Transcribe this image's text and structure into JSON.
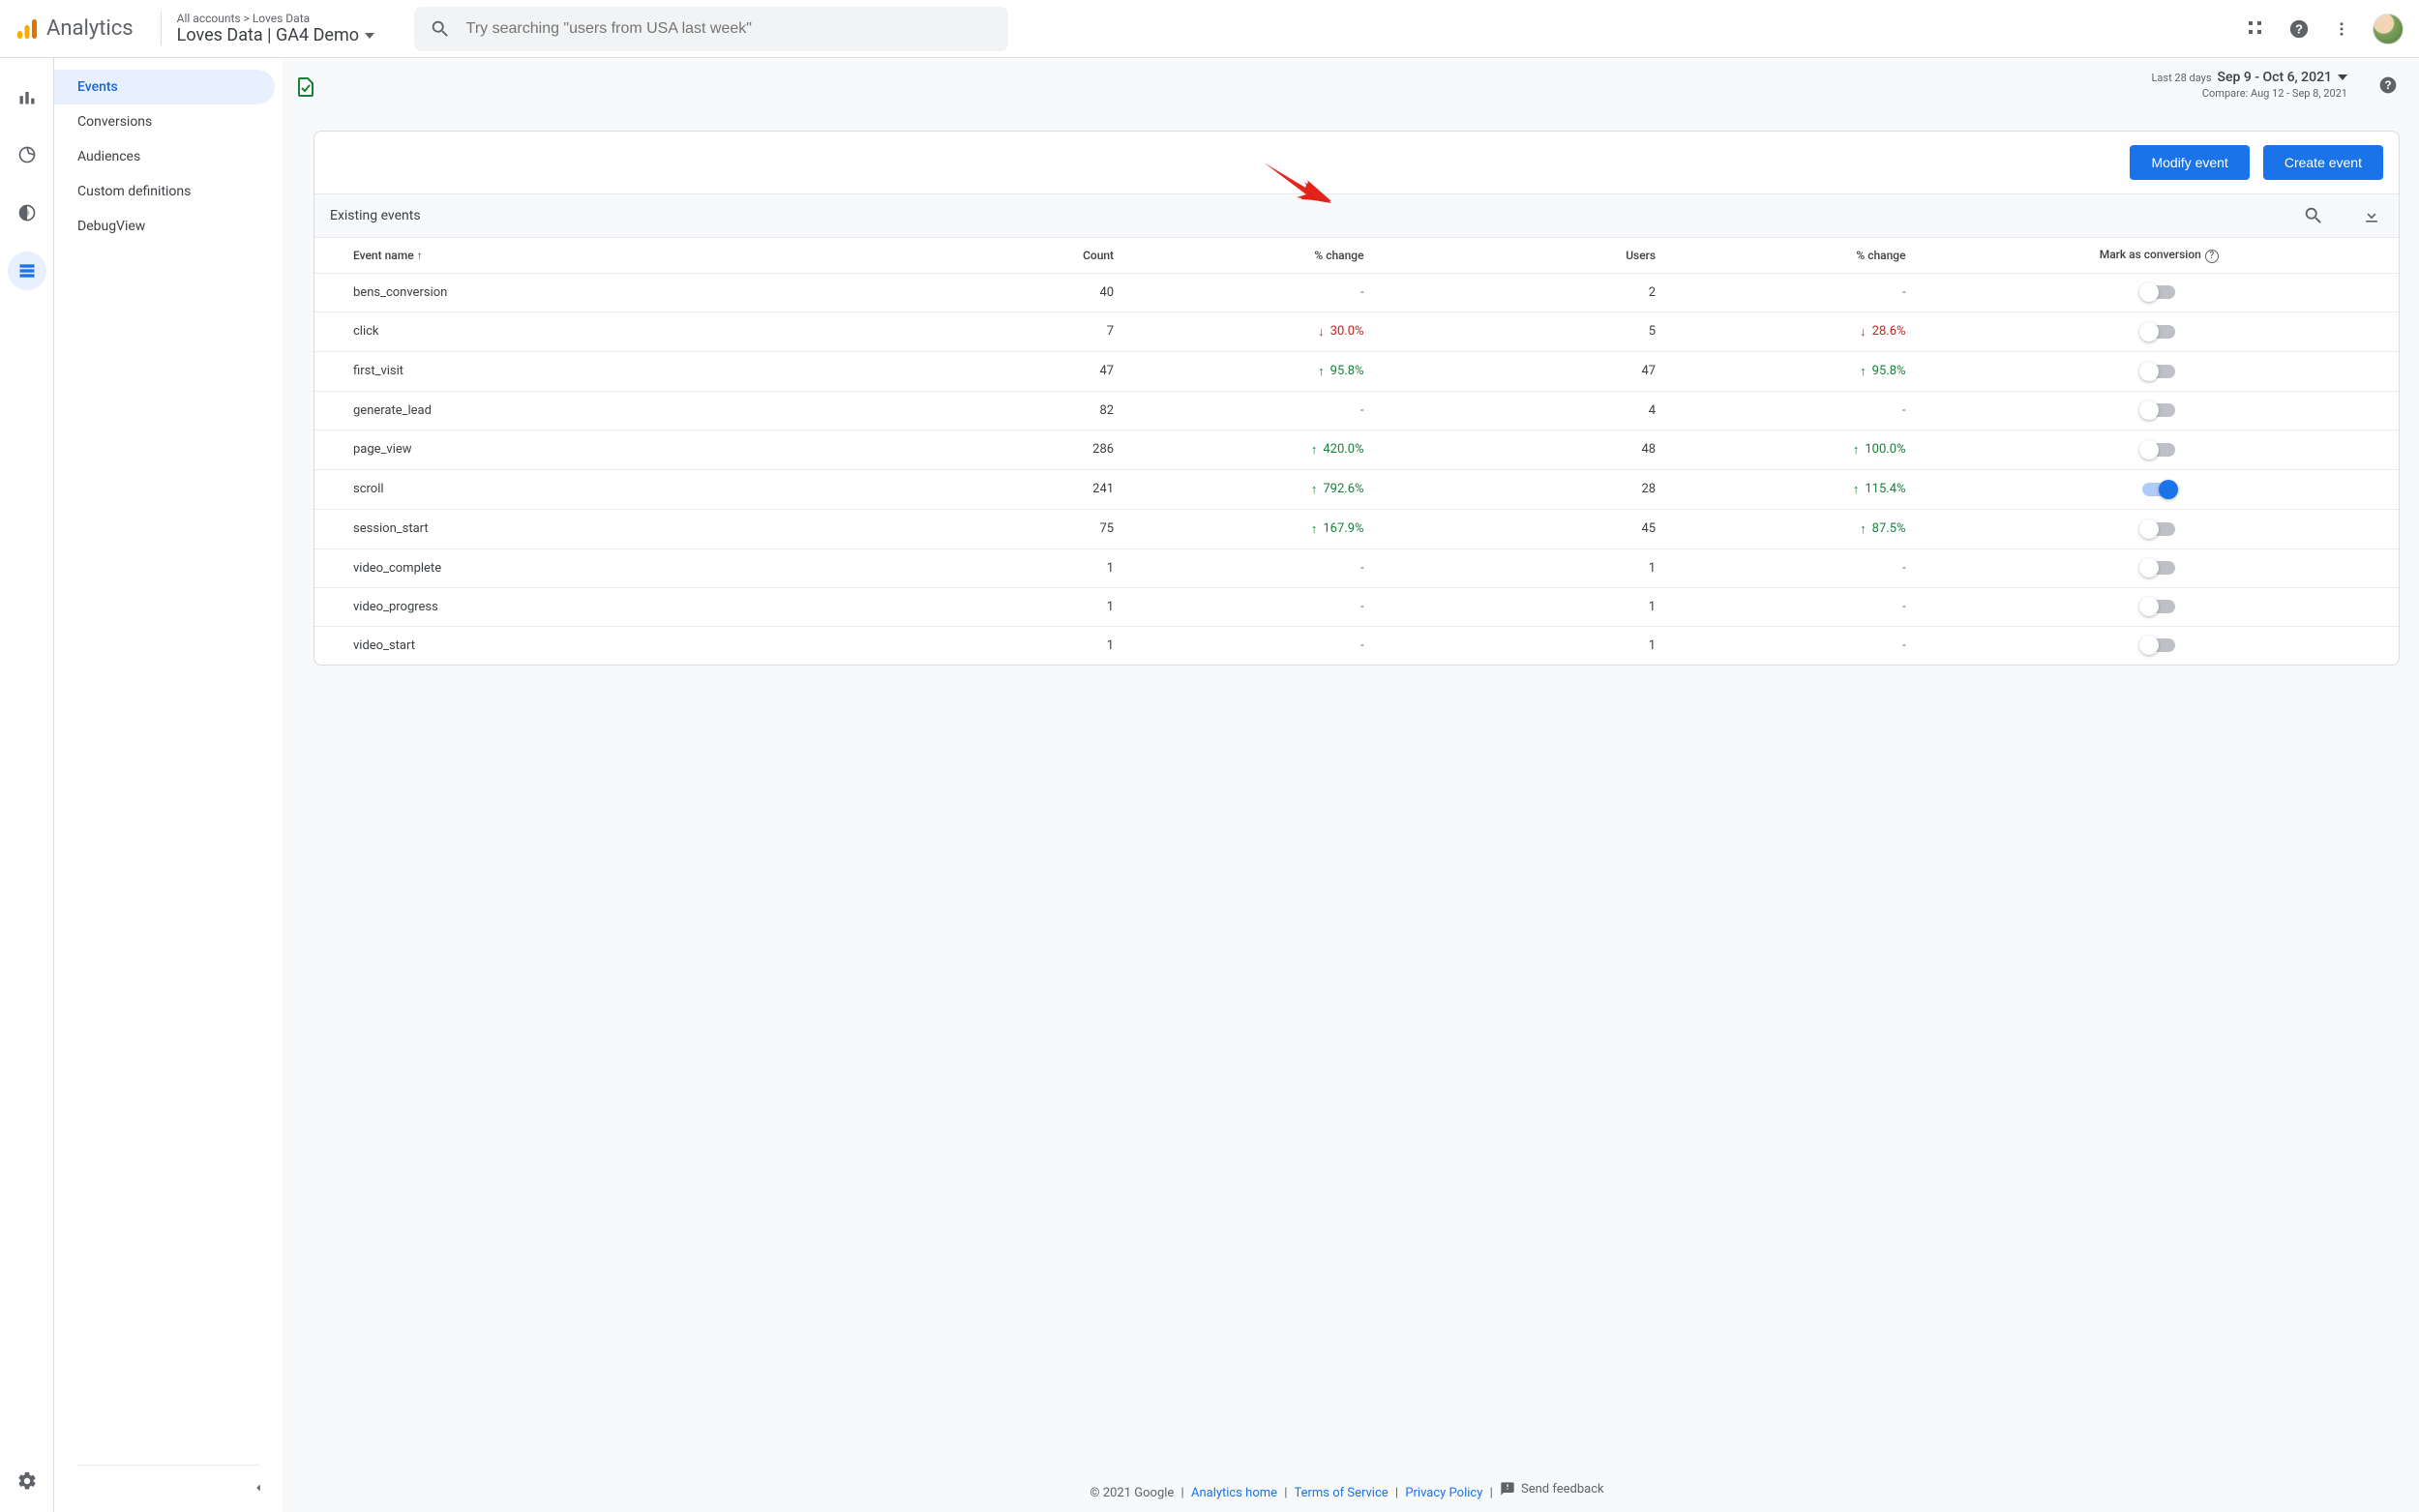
{
  "header": {
    "logo_text": "Analytics",
    "breadcrumb": "All accounts > Loves Data",
    "property": "Loves Data | GA4 Demo",
    "search_placeholder": "Try searching \"users from USA last week\""
  },
  "subnav": {
    "items": [
      {
        "label": "Events",
        "active": true
      },
      {
        "label": "Conversions",
        "active": false
      },
      {
        "label": "Audiences",
        "active": false
      },
      {
        "label": "Custom definitions",
        "active": false
      },
      {
        "label": "DebugView",
        "active": false
      }
    ]
  },
  "dates": {
    "prefix": "Last 28 days",
    "range": "Sep 9 - Oct 6, 2021",
    "compare": "Compare: Aug 12 - Sep 8, 2021"
  },
  "card": {
    "modify_label": "Modify event",
    "create_label": "Create event",
    "subhead": "Existing events"
  },
  "columns": {
    "name": "Event name",
    "count": "Count",
    "change1": "% change",
    "users": "Users",
    "change2": "% change",
    "mark": "Mark as conversion"
  },
  "events": [
    {
      "name": "bens_conversion",
      "count": "40",
      "cchg": null,
      "cdir": null,
      "users": "2",
      "uchg": null,
      "udir": null,
      "on": false
    },
    {
      "name": "click",
      "count": "7",
      "cchg": "30.0%",
      "cdir": "down",
      "users": "5",
      "uchg": "28.6%",
      "udir": "down",
      "on": false
    },
    {
      "name": "first_visit",
      "count": "47",
      "cchg": "95.8%",
      "cdir": "up",
      "users": "47",
      "uchg": "95.8%",
      "udir": "up",
      "on": false
    },
    {
      "name": "generate_lead",
      "count": "82",
      "cchg": null,
      "cdir": null,
      "users": "4",
      "uchg": null,
      "udir": null,
      "on": false
    },
    {
      "name": "page_view",
      "count": "286",
      "cchg": "420.0%",
      "cdir": "up",
      "users": "48",
      "uchg": "100.0%",
      "udir": "up",
      "on": false
    },
    {
      "name": "scroll",
      "count": "241",
      "cchg": "792.6%",
      "cdir": "up",
      "users": "28",
      "uchg": "115.4%",
      "udir": "up",
      "on": true
    },
    {
      "name": "session_start",
      "count": "75",
      "cchg": "167.9%",
      "cdir": "up",
      "users": "45",
      "uchg": "87.5%",
      "udir": "up",
      "on": false
    },
    {
      "name": "video_complete",
      "count": "1",
      "cchg": null,
      "cdir": null,
      "users": "1",
      "uchg": null,
      "udir": null,
      "on": false
    },
    {
      "name": "video_progress",
      "count": "1",
      "cchg": null,
      "cdir": null,
      "users": "1",
      "uchg": null,
      "udir": null,
      "on": false
    },
    {
      "name": "video_start",
      "count": "1",
      "cchg": null,
      "cdir": null,
      "users": "1",
      "uchg": null,
      "udir": null,
      "on": false
    }
  ],
  "footer": {
    "copyright": "© 2021 Google",
    "home": "Analytics home",
    "terms": "Terms of Service",
    "privacy": "Privacy Policy",
    "feedback": "Send feedback"
  }
}
